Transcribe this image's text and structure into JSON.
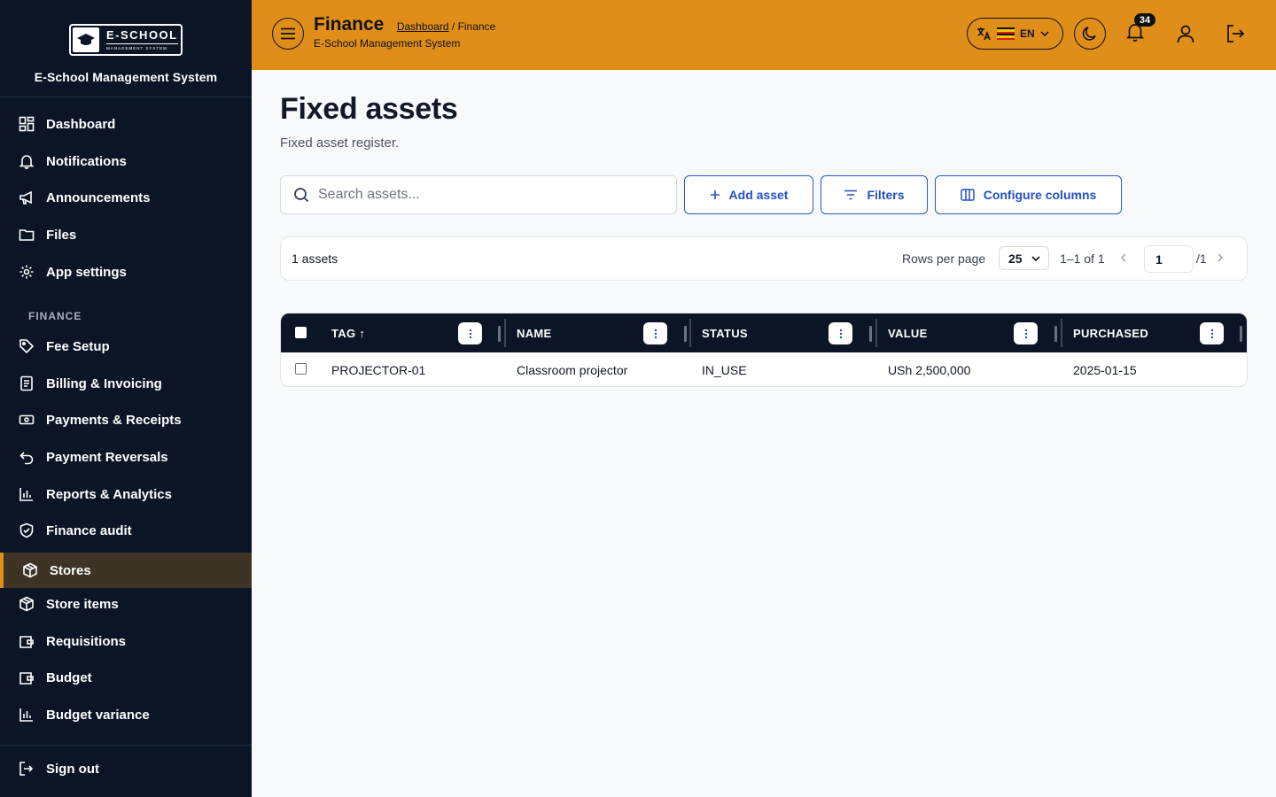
{
  "brand": {
    "logo_title": "E-SCHOOL",
    "logo_subtitle": "MANAGEMENT SYSTEM",
    "name": "E-School Management System"
  },
  "sidebar": {
    "items": [
      {
        "label": "Dashboard",
        "icon": "dashboard-icon"
      },
      {
        "label": "Notifications",
        "icon": "bell-icon"
      },
      {
        "label": "Announcements",
        "icon": "megaphone-icon"
      },
      {
        "label": "Files",
        "icon": "folder-icon"
      },
      {
        "label": "App settings",
        "icon": "gear-icon"
      }
    ],
    "finance_title": "FINANCE",
    "finance_items": [
      {
        "label": "Fee Setup",
        "icon": "tag-icon"
      },
      {
        "label": "Billing & Invoicing",
        "icon": "receipt-icon"
      },
      {
        "label": "Payments & Receipts",
        "icon": "banknote-icon"
      },
      {
        "label": "Payment Reversals",
        "icon": "undo-icon"
      },
      {
        "label": "Reports & Analytics",
        "icon": "bar-chart-icon"
      },
      {
        "label": "Finance audit",
        "icon": "shield-check-icon"
      },
      {
        "label": "Stores",
        "icon": "package-icon",
        "active": true
      },
      {
        "label": "Store items",
        "icon": "package-icon"
      },
      {
        "label": "Requisitions",
        "icon": "wallet-icon"
      },
      {
        "label": "Budget",
        "icon": "wallet-icon"
      },
      {
        "label": "Budget variance",
        "icon": "bar-chart-icon"
      }
    ],
    "signout": "Sign out"
  },
  "topbar": {
    "title": "Finance",
    "breadcrumb_link": "Dashboard",
    "breadcrumb_sep": "/",
    "breadcrumb_current": "Finance",
    "subtitle": "E-School Management System",
    "language": "EN",
    "notification_count": "34",
    "accent": "#e08e1a"
  },
  "main": {
    "title": "Fixed assets",
    "subtitle": "Fixed asset register.",
    "search_placeholder": "Search assets...",
    "add_label": "Add asset",
    "filters_label": "Filters",
    "configure_label": "Configure columns",
    "count_label": "1 assets",
    "rows_per_page_label": "Rows per page",
    "rows_per_page": "25",
    "range": "1–1 of 1",
    "page": "1",
    "page_total": "/1"
  },
  "table": {
    "columns": [
      "TAG",
      "NAME",
      "STATUS",
      "VALUE",
      "PURCHASED"
    ],
    "sort_indicator": "↑",
    "rows": [
      [
        "PROJECTOR-01",
        "Classroom projector",
        "IN_USE",
        "USh 2,500,000",
        "2025-01-15"
      ]
    ]
  }
}
